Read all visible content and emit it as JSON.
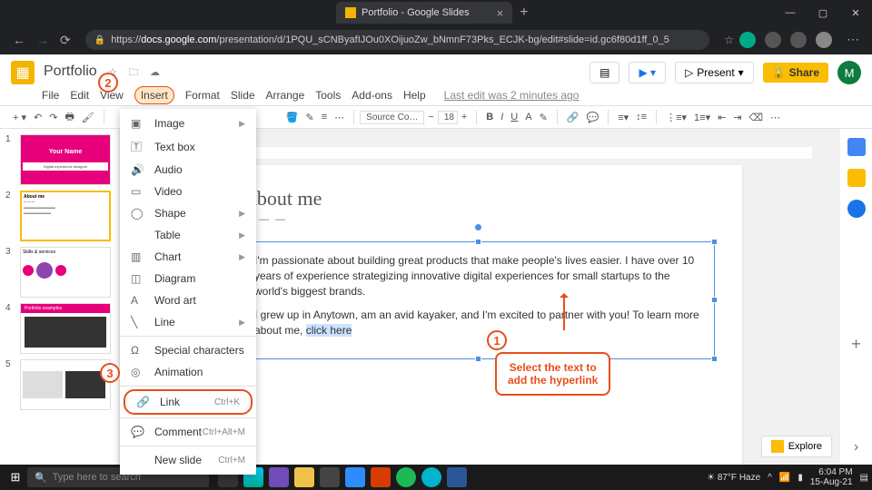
{
  "browser": {
    "tab_title": "Portfolio - Google Slides",
    "url_host": "https://",
    "url_domain": "docs.google.com",
    "url_path": "/presentation/d/1PQU_sCNByafIJOu0XOijuoZw_bNmnF73Pks_ECJK-bg/edit#slide=id.gc6f80d1ff_0_5"
  },
  "doc": {
    "title": "Portfolio",
    "last_edit": "Last edit was 2 minutes ago"
  },
  "header": {
    "present": "Present",
    "share": "Share",
    "avatar": "M"
  },
  "menu": [
    "File",
    "Edit",
    "View",
    "Insert",
    "Format",
    "Slide",
    "Arrange",
    "Tools",
    "Add-ons",
    "Help"
  ],
  "insert_menu": {
    "image": "Image",
    "textbox": "Text box",
    "audio": "Audio",
    "video": "Video",
    "shape": "Shape",
    "table": "Table",
    "chart": "Chart",
    "diagram": "Diagram",
    "wordart": "Word art",
    "line": "Line",
    "special": "Special characters",
    "animation": "Animation",
    "link": "Link",
    "link_sc": "Ctrl+K",
    "comment": "Comment",
    "comment_sc": "Ctrl+Alt+M",
    "newslide": "New slide",
    "newslide_sc": "Ctrl+M"
  },
  "toolbar": {
    "font": "Source Co…",
    "size": "18"
  },
  "slide": {
    "title": "About me",
    "p1": "I'm passionate about building great products that make people's lives easier. I have over 10 years of experience strategizing innovative digital experiences for small startups to the world's biggest brands.",
    "p2a": "I grew up in Anytown, am an avid kayaker, and I'm excited to partner with you! To learn more about me, ",
    "p2b": "click here"
  },
  "thumbs": {
    "t1": "Your Name",
    "t1sub": "Digital experience designer",
    "t2": "About me",
    "t3": "Skills & services",
    "t4": "Portfolio examples"
  },
  "annotations": {
    "n1": "1",
    "n2": "2",
    "n3": "3",
    "box1a": "Select the text to",
    "box1b": "add the hyperlink"
  },
  "explore": "Explore",
  "taskbar": {
    "search": "Type here to search",
    "weather": "87°F Haze",
    "time": "6:04 PM",
    "date": "15-Aug-21"
  }
}
